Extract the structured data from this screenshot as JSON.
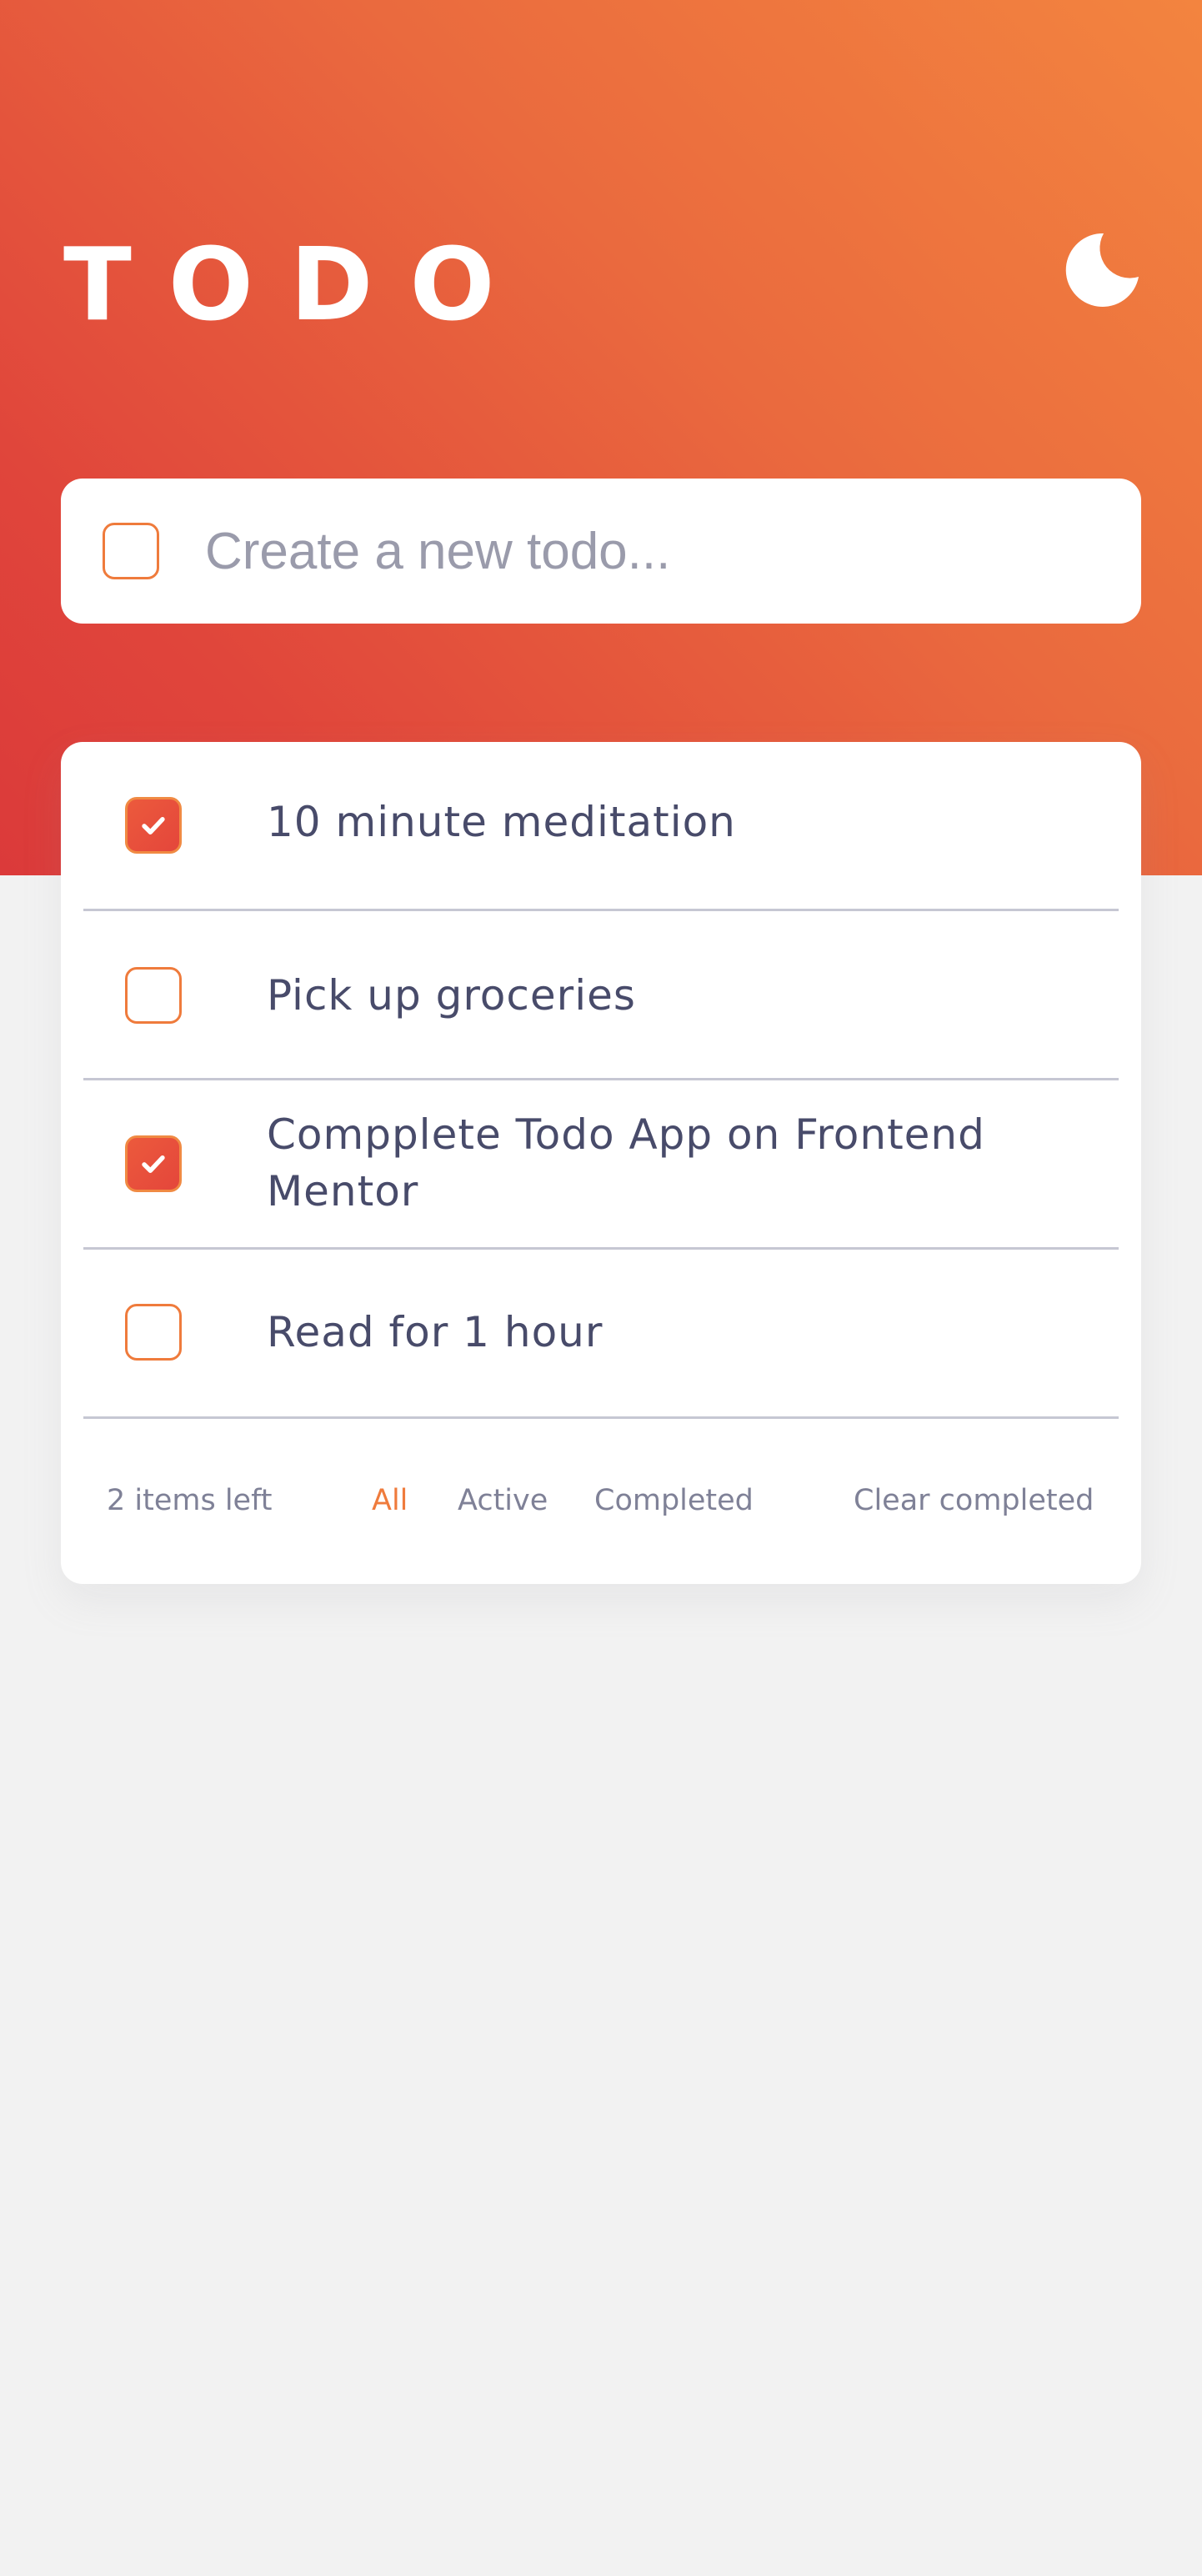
{
  "header": {
    "title": "TODO",
    "theme_toggle_icon": "moon-icon"
  },
  "new_todo": {
    "placeholder": "Create a new todo...",
    "value": ""
  },
  "todos": [
    {
      "text": "10 minute meditation",
      "completed": true
    },
    {
      "text": "Pick up groceries",
      "completed": false
    },
    {
      "text": "Compplete Todo App on Frontend Mentor",
      "completed": true
    },
    {
      "text": "Read for 1 hour",
      "completed": false
    }
  ],
  "footer": {
    "items_left": "2 items left",
    "filters": [
      "All",
      "Active",
      "Completed"
    ],
    "active_filter": "All",
    "clear_label": "Clear completed"
  },
  "colors": {
    "gradient_start": "#f3843f",
    "gradient_end": "#db3a3a",
    "accent": "#ef7b3c",
    "text": "#484b6a",
    "muted": "#7f8197",
    "background": "#f2f2f2"
  }
}
